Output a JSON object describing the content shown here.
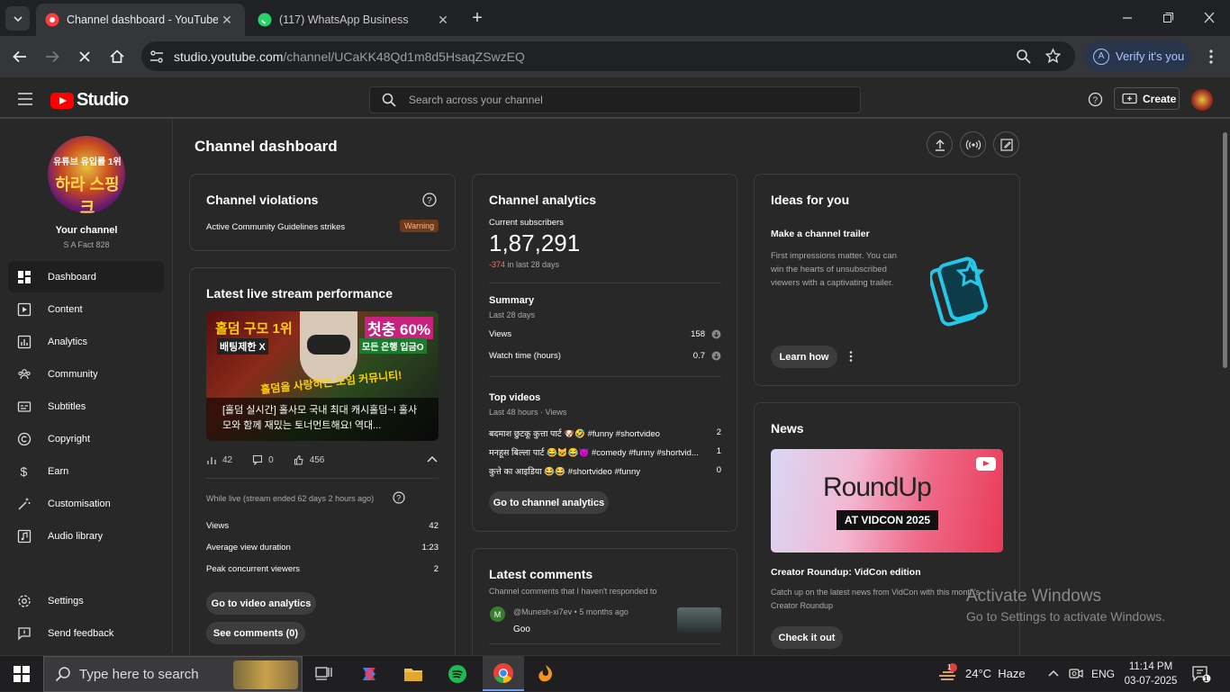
{
  "browser": {
    "tabs": [
      {
        "title": "Channel dashboard - YouTube Studio",
        "favicon": "youtube-studio-icon"
      },
      {
        "title": "(117) WhatsApp Business",
        "favicon": "whatsapp-icon"
      }
    ],
    "url_host": "studio.youtube.com",
    "url_path": "/channel/UCaKK48Qd1m8d5HsaqZSwzEQ",
    "verify_label": "Verify it's you",
    "verify_avatar": "A"
  },
  "header": {
    "logo_text": "Studio",
    "search_placeholder": "Search across your channel",
    "create_label": "Create"
  },
  "sidebar": {
    "avatar_line1": "유튜브 유입률 1위",
    "avatar_line2": "하라 스핑크",
    "your_channel": "Your channel",
    "channel_name": "S A Fact 828",
    "items": [
      {
        "label": "Dashboard",
        "icon": "dashboard-icon",
        "active": true
      },
      {
        "label": "Content",
        "icon": "content-icon"
      },
      {
        "label": "Analytics",
        "icon": "analytics-icon"
      },
      {
        "label": "Community",
        "icon": "community-icon"
      },
      {
        "label": "Subtitles",
        "icon": "subtitles-icon"
      },
      {
        "label": "Copyright",
        "icon": "copyright-icon"
      },
      {
        "label": "Earn",
        "icon": "earn-icon"
      },
      {
        "label": "Customisation",
        "icon": "customisation-icon"
      },
      {
        "label": "Audio library",
        "icon": "audio-library-icon"
      }
    ],
    "settings_label": "Settings",
    "feedback_label": "Send feedback"
  },
  "main": {
    "title": "Channel dashboard",
    "violations": {
      "title": "Channel violations",
      "row_label": "Active Community Guidelines strikes",
      "badge": "Warning"
    },
    "live": {
      "title": "Latest live stream performance",
      "thumb_tag1": "홀덤 구모 1위",
      "thumb_tag2": "배팅제한 X",
      "thumb_tag3": "첫충 60%",
      "thumb_tag4": "모든 은행 입금O",
      "thumb_tag5": "홀덤을 사랑하는 모임 커뮤니티!",
      "thumb_caption": "[홀덤 실시간] 홀사모 국내 최대 캐시홀덤~! 홀사모와 함께 재밌는 토너먼트해요! 역대...",
      "stat_views": "42",
      "stat_comments": "0",
      "stat_likes": "456",
      "ended_note": "While live (stream ended 62 days 2 hours ago)",
      "rows": [
        {
          "label": "Views",
          "value": "42"
        },
        {
          "label": "Average view duration",
          "value": "1:23"
        },
        {
          "label": "Peak concurrent viewers",
          "value": "2"
        }
      ],
      "btn_analytics": "Go to video analytics",
      "btn_comments": "See comments (0)"
    },
    "analytics": {
      "title": "Channel analytics",
      "subs_label": "Current subscribers",
      "subs_value": "1,87,291",
      "subs_change": "-374",
      "subs_change_suffix": " in last 28 days",
      "summary_title": "Summary",
      "summary_sub": "Last 28 days",
      "summary_rows": [
        {
          "label": "Views",
          "value": "158"
        },
        {
          "label": "Watch time (hours)",
          "value": "0.7"
        }
      ],
      "top_title": "Top videos",
      "top_sub": "Last 48 hours · Views",
      "top_videos": [
        {
          "title": "बदमाश छुटकू कुत्ता पार्ट 🐶🤣 #funny #shortvideo",
          "views": "2"
        },
        {
          "title": "मनहूस बिल्ला पार्ट 😂🐱😂👿 #comedy #funny #shortvid...",
          "views": "1"
        },
        {
          "title": "कुत्ते का आइडिया 😂😂 #shortvideo #funny",
          "views": "0"
        }
      ],
      "btn": "Go to channel analytics"
    },
    "comments": {
      "title": "Latest comments",
      "sub": "Channel comments that I haven't responded to",
      "items": [
        {
          "avatar": "M",
          "author": "@Munesh-xi7ev",
          "time": "5 months ago",
          "text": "Goo"
        }
      ]
    },
    "ideas": {
      "title": "Ideas for you",
      "heading": "Make a channel trailer",
      "body": "First impressions matter. You can win the hearts of unsubscribed viewers with a captivating trailer.",
      "btn": "Learn how"
    },
    "news": {
      "title": "News",
      "image_title": "RoundUp",
      "image_badge": "AT VIDCON 2025",
      "heading": "Creator Roundup: VidCon edition",
      "body": "Catch up on the latest news from VidCon with this month's Creator Roundup",
      "btn": "Check it out"
    }
  },
  "watermark": {
    "line1": "Activate Windows",
    "line2": "Go to Settings to activate Windows."
  },
  "taskbar": {
    "search_placeholder": "Type here to search",
    "weather": "24°C  Haze",
    "weather_badge": "1",
    "lang": "ENG",
    "time": "11:14 PM",
    "date": "03-07-2025",
    "notif_count": "1"
  },
  "colors": {
    "brand_red": "#ff0000",
    "warning_bg": "#6b3b1b",
    "warning_fg": "#ffb38a",
    "negative": "#ff6b6b",
    "idea_icon": "#25c7e8"
  }
}
